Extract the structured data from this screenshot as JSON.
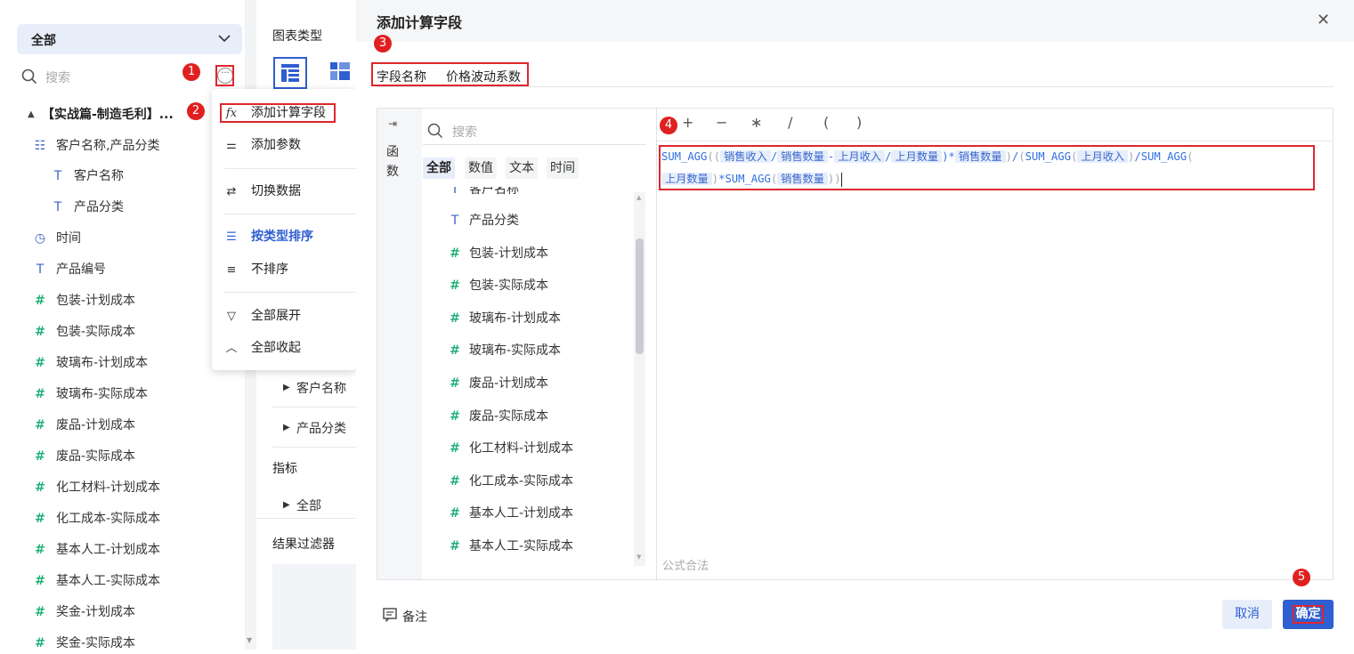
{
  "left": {
    "select_label": "全部",
    "search_placeholder": "搜索",
    "dataset_title": "【实战篇-制造毛利】...",
    "group_label": "客户名称,产品分类",
    "fields": [
      {
        "name": "客户名称",
        "type": "text",
        "indent": true
      },
      {
        "name": "产品分类",
        "type": "text",
        "indent": true
      },
      {
        "name": "时间",
        "type": "time",
        "indent": false
      },
      {
        "name": "产品编号",
        "type": "text",
        "indent": false
      },
      {
        "name": "包装-计划成本",
        "type": "number",
        "indent": false
      },
      {
        "name": "包装-实际成本",
        "type": "number",
        "indent": false
      },
      {
        "name": "玻璃布-计划成本",
        "type": "number",
        "indent": false
      },
      {
        "name": "玻璃布-实际成本",
        "type": "number",
        "indent": false
      },
      {
        "name": "废品-计划成本",
        "type": "number",
        "indent": false
      },
      {
        "name": "废品-实际成本",
        "type": "number",
        "indent": false
      },
      {
        "name": "化工材料-计划成本",
        "type": "number",
        "indent": false
      },
      {
        "name": "化工成本-实际成本",
        "type": "number",
        "indent": false
      },
      {
        "name": "基本人工-计划成本",
        "type": "number",
        "indent": false
      },
      {
        "name": "基本人工-实际成本",
        "type": "number",
        "indent": false
      },
      {
        "name": "奖金-计划成本",
        "type": "number",
        "indent": false
      },
      {
        "name": "奖金-实际成本",
        "type": "number",
        "indent": false
      }
    ]
  },
  "middle": {
    "chart_type_label": "图表类型",
    "dims": [
      "客户名称",
      "产品分类"
    ],
    "metrics_label": "指标",
    "metrics_all": "全部",
    "filter_label": "结果过滤器"
  },
  "menu": {
    "items": [
      "添加计算字段",
      "添加参数",
      "切换数据",
      "按类型排序",
      "不排序",
      "全部展开",
      "全部收起"
    ]
  },
  "badges": [
    "1",
    "2",
    "3",
    "4",
    "5"
  ],
  "dialog": {
    "title": "添加计算字段",
    "close_glyph": "✕",
    "field_name_label": "字段名称",
    "field_name_value": "价格波动系数",
    "side_label_1": "函",
    "side_label_2": "数",
    "search_placeholder": "搜索",
    "tabs": [
      "全部",
      "数值",
      "文本",
      "时间"
    ],
    "partial_item": "客户名称",
    "field_list": [
      {
        "name": "产品分类",
        "type": "text"
      },
      {
        "name": "包装-计划成本",
        "type": "number"
      },
      {
        "name": "包装-实际成本",
        "type": "number"
      },
      {
        "name": "玻璃布-计划成本",
        "type": "number"
      },
      {
        "name": "玻璃布-实际成本",
        "type": "number"
      },
      {
        "name": "废品-计划成本",
        "type": "number"
      },
      {
        "name": "废品-实际成本",
        "type": "number"
      },
      {
        "name": "化工材料-计划成本",
        "type": "number"
      },
      {
        "name": "化工成本-实际成本",
        "type": "number"
      },
      {
        "name": "基本人工-计划成本",
        "type": "number"
      },
      {
        "name": "基本人工-实际成本",
        "type": "number"
      }
    ],
    "operators": [
      "+",
      "−",
      "∗",
      "/",
      "(",
      ")"
    ],
    "formula": {
      "sum_agg": "SUM_AGG",
      "t_sales_income": "销售收入",
      "t_sales_qty": "销售数量",
      "t_last_income": "上月收入",
      "t_last_qty": "上月数量"
    },
    "formula_status": "公式合法",
    "note_label": "备注",
    "cancel_label": "取消",
    "ok_label": "确定"
  },
  "colors": {
    "accent": "#2f5fd0",
    "hash_green": "#22b07a",
    "annotation_red": "#e02020"
  }
}
